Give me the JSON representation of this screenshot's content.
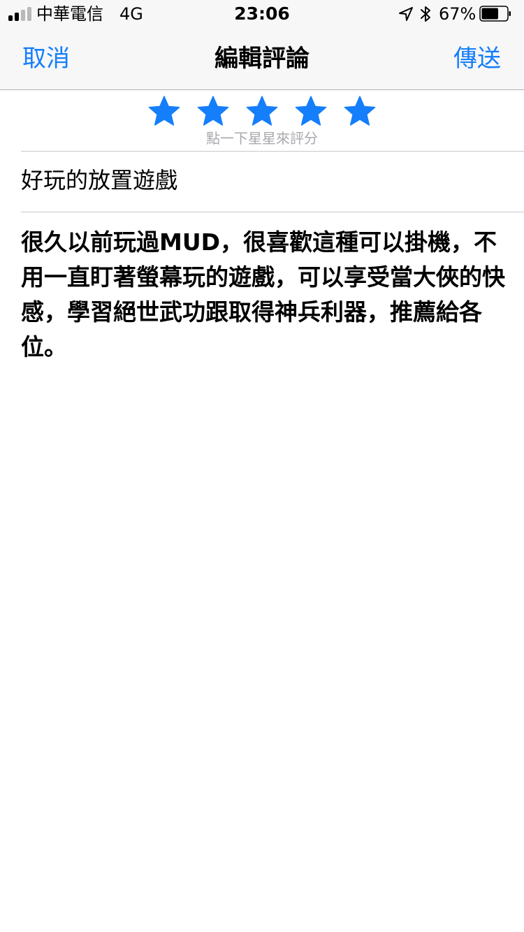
{
  "status_bar": {
    "carrier": "中華電信",
    "network": "4G",
    "time": "23:06",
    "battery_percent": "67%",
    "signal_bars_filled": 2,
    "signal_bars_total": 4,
    "battery_level": 0.67,
    "icons": [
      "location-arrow-icon",
      "bluetooth-icon",
      "battery-icon"
    ]
  },
  "nav": {
    "cancel_label": "取消",
    "title": "編輯評論",
    "send_label": "傳送"
  },
  "rating": {
    "stars_filled": 5,
    "stars_total": 5,
    "hint": "點一下星星來評分"
  },
  "review": {
    "title": "好玩的放置遊戲",
    "body": "很久以前玩過MUD，很喜歡這種可以掛機，不用一直盯著螢幕玩的遊戲，可以享受當大俠的快感，學習絕世武功跟取得神兵利器，推薦給各位。"
  },
  "colors": {
    "accent": "#147efb",
    "bar_background": "#f7f7f8",
    "hint_text": "#a9a9ae",
    "divider": "#c8c7cc"
  }
}
